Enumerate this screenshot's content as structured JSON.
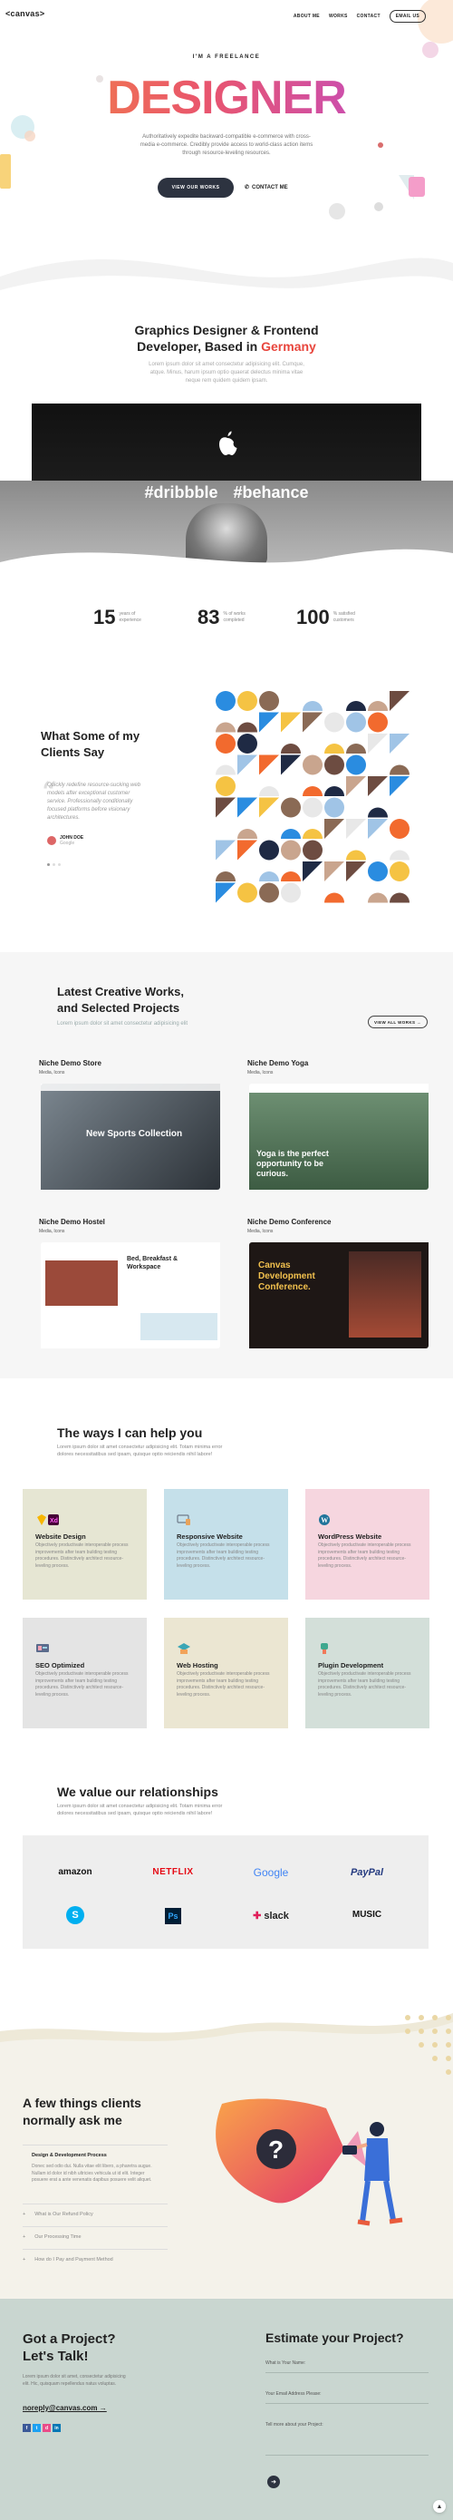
{
  "header": {
    "logo": "<canvas>",
    "nav": [
      "ABOUT ME",
      "WORKS",
      "CONTACT"
    ],
    "email_button": "EMAIL US"
  },
  "hero": {
    "tagline": "I'M A FREELANCE",
    "title": "DESIGNER",
    "description": "Authoritatively expedite backward-compatible e-commerce with cross-media e-commerce. Credibly provide access to world-class action items through resource-leveling resources.",
    "primary_button": "VIEW OUR WORKS",
    "secondary_button": "CONTACT ME"
  },
  "about": {
    "title_line1": "Graphics Designer & Frontend",
    "title_line2_prefix": "Developer, Based in ",
    "title_highlight": "Germany",
    "description": "Lorem ipsum dolor sit amet consectetur adipisicing elit. Cumque, atque. Minus, harum ipsum optio quaerat delectus minima vitae neque rem quidem quidem ipsam.",
    "hashtags": "#dribbble #behance",
    "accent_color": "#e8453c"
  },
  "stats": [
    {
      "number": "15",
      "label": "years of experience"
    },
    {
      "number": "83",
      "label": "% of works completed"
    },
    {
      "number": "100",
      "label": "% satisfied customers"
    }
  ],
  "testimonials": {
    "title_line1": "What Some of my",
    "title_line2": "Clients Say",
    "quote": "Quickly redefine resource-sucking web models after exceptional customer service. Professionally conditionally focused platforms before visionary architectures.",
    "author": "JOHN DOE",
    "author_role": "Google"
  },
  "projects": {
    "title_line1": "Latest Creative Works,",
    "title_line2": "and Selected Projects",
    "subtitle": "Lorem ipsum dolor sit amet consectetur adipisicing elit",
    "view_all": "VIEW ALL WORKS",
    "cards": [
      {
        "title": "Niche Demo Store",
        "sub": "Media, Icons",
        "caption": "New Sports Collection",
        "color": "#e5ece9"
      },
      {
        "title": "Niche Demo Yoga",
        "sub": "Media, Icons",
        "caption": "Yoga is the perfect opportunity to be curious.",
        "color": "#f6dcc9"
      },
      {
        "title": "Niche Demo Hostel",
        "sub": "Media, Icons",
        "caption": "Bed, Breakfast & Workspace",
        "color": "#e3e2f4"
      },
      {
        "title": "Niche Demo Conference",
        "sub": "Media, Icons",
        "caption": "Canvas Development Conference.",
        "color": "#ecebe3"
      }
    ]
  },
  "services": {
    "title": "The ways I can help you",
    "subtitle": "Lorem ipsum dolor sit amet consectetur adipisicing elit. Totam minima error dolores necessitatibus sed ipsam, quisque optio reiciendis nihil labore!",
    "items": [
      {
        "title": "Website Design",
        "icon": "sketch-xd-icon",
        "color": "#e6e6d3",
        "desc": "Objectively productivate interoperable process improvements after team building testing procedures. Distinctively architect resource-leveling process."
      },
      {
        "title": "Responsive Website",
        "icon": "responsive-devices-icon",
        "color": "#c5e0ea",
        "desc": "Objectively productivate interoperable process improvements after team building testing procedures. Distinctively architect resource-leveling process."
      },
      {
        "title": "WordPress Website",
        "icon": "wordpress-icon",
        "color": "#f6d6df",
        "desc": "Objectively productivate interoperable process improvements after team building testing procedures. Distinctively architect resource-leveling process."
      },
      {
        "title": "SEO Optimized",
        "icon": "seo-monitor-icon",
        "color": "#e4e4e4",
        "desc": "Objectively productivate interoperable process improvements after team building testing procedures. Distinctively architect resource-leveling process."
      },
      {
        "title": "Web Hosting",
        "icon": "hosting-server-icon",
        "color": "#ebe6d2",
        "desc": "Objectively productivate interoperable process improvements after team building testing procedures. Distinctively architect resource-leveling process."
      },
      {
        "title": "Plugin Development",
        "icon": "plugin-icon",
        "color": "#d3dfd9",
        "desc": "Objectively productivate interoperable process improvements after team building testing procedures. Distinctively architect resource-leveling process."
      }
    ]
  },
  "partners": {
    "title": "We value our relationships",
    "subtitle": "Lorem ipsum dolor sit amet consectetur adipisicing elit. Totam minima error dolores necessitatibus sed ipsam, quisque optio reiciendis nihil labore!",
    "logos": [
      "amazon",
      "NETFLIX",
      "Google",
      "PayPal",
      "skype",
      "Ps",
      "slack",
      "MUSIC"
    ]
  },
  "faq": {
    "title_line1": "A few things clients",
    "title_line2": "normally ask me",
    "active_q": "Design & Development Process",
    "active_a": "Donec sed odio dui. Nulla vitae elit libero, a pharetra augue. Nullam id dolor id nibh ultricies vehicula ut id elit. Integer posuere erat a ante venenatis dapibus posuere velit aliquet.",
    "items": [
      "What is Our Refund Policy",
      "Our Processing Time",
      "How do I Pay and Payment Method"
    ]
  },
  "contact": {
    "title_line1": "Got a Project?",
    "title_line2": "Let's Talk!",
    "desc": "Lorem ipsum dolor sit amet, consectetur adipisicing elit. Hic, quisquam repellendus natus voluptas.",
    "email": "noreply@canvas.com",
    "estimate_title": "Estimate your Project?",
    "fields": [
      "What is Your Name:",
      "Your Email Address Please:",
      "Tell more about your Project:"
    ],
    "socials": [
      "f",
      "t",
      "d",
      "in"
    ]
  }
}
